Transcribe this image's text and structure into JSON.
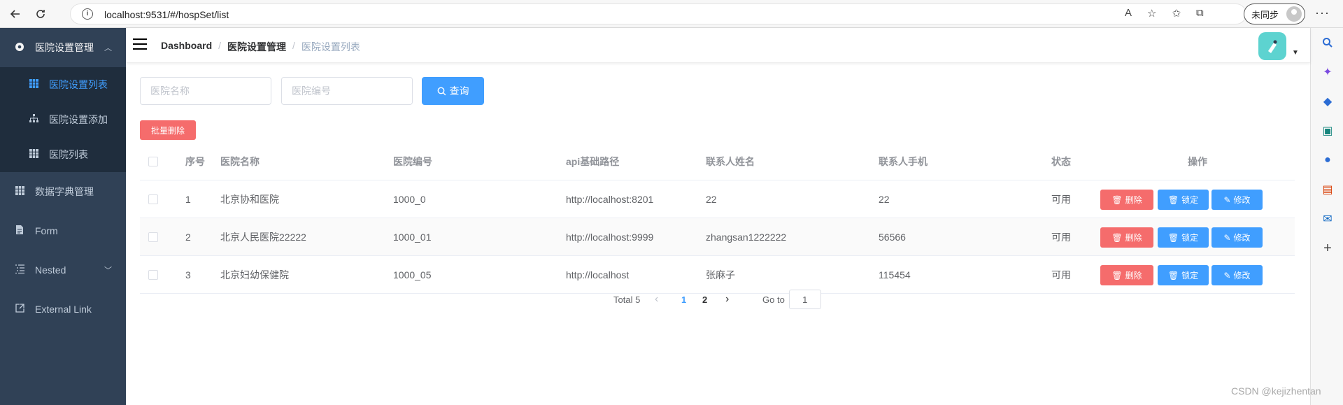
{
  "browser": {
    "url": "localhost:9531/#/hospSet/list",
    "sync_label": "未同步"
  },
  "sidebar": {
    "groups": [
      {
        "label": "医院设置管理",
        "icon": "settings-icon"
      },
      {
        "label": "数据字典管理",
        "icon": "grid-icon"
      },
      {
        "label": "Form",
        "icon": "form-icon"
      },
      {
        "label": "Nested",
        "icon": "nested-icon"
      },
      {
        "label": "External Link",
        "icon": "external-link-icon"
      }
    ],
    "sub_items": [
      {
        "label": "医院设置列表",
        "icon": "table-icon",
        "active": true
      },
      {
        "label": "医院设置添加",
        "icon": "tree-icon",
        "active": false
      },
      {
        "label": "医院列表",
        "icon": "table-icon",
        "active": false
      }
    ]
  },
  "breadcrumb": [
    "Dashboard",
    "医院设置管理",
    "医院设置列表"
  ],
  "search": {
    "name_placeholder": "医院名称",
    "code_placeholder": "医院编号",
    "query_label": "查询"
  },
  "batch_delete_label": "批量删除",
  "table": {
    "columns": [
      "序号",
      "医院名称",
      "医院编号",
      "api基础路径",
      "联系人姓名",
      "联系人手机",
      "状态",
      "操作"
    ],
    "rows": [
      {
        "index": "1",
        "name": "北京协和医院",
        "code": "1000_0",
        "api": "http://localhost:8201",
        "contact": "22",
        "phone": "22",
        "status": "可用"
      },
      {
        "index": "2",
        "name": "北京人民医院22222",
        "code": "1000_01",
        "api": "http://localhost:9999",
        "contact": "zhangsan1222222",
        "phone": "56566",
        "status": "可用"
      },
      {
        "index": "3",
        "name": "北京妇幼保健院",
        "code": "1000_05",
        "api": "http://localhost",
        "contact": "张麻子",
        "phone": "115454",
        "status": "可用"
      }
    ],
    "actions": {
      "delete": "删除",
      "lock": "锁定",
      "edit": "修改"
    }
  },
  "pagination": {
    "total_label": "Total 5",
    "pages": [
      "1",
      "2"
    ],
    "current_page": "1",
    "goto_label": "Go to",
    "goto_value": "1"
  },
  "watermark": "CSDN @kejizhentan",
  "colors": {
    "sidebar_bg": "#304156",
    "primary": "#409eff",
    "danger": "#f56c6c"
  }
}
